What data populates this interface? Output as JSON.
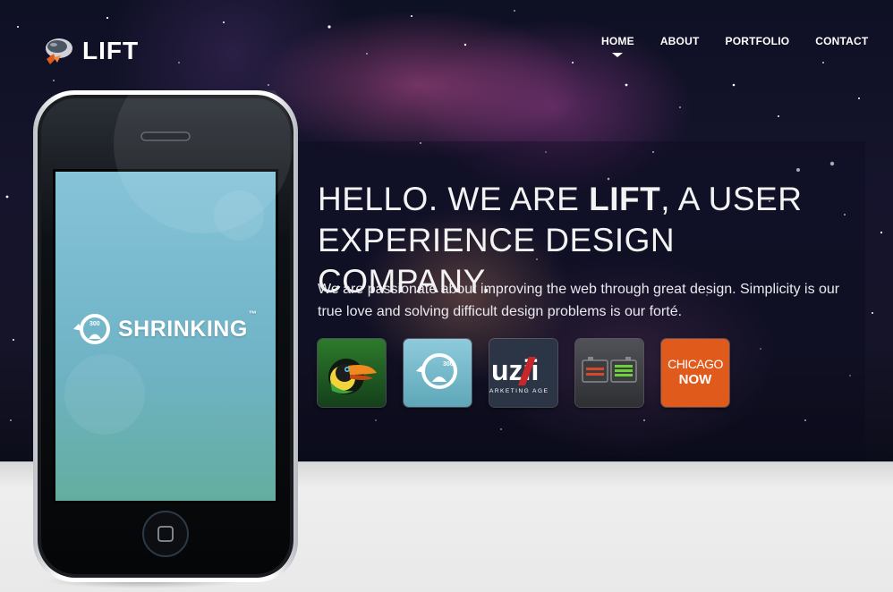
{
  "header": {
    "logo_text": "LIFT",
    "logo_icon": "rocket-helmet-icon"
  },
  "nav": {
    "items": [
      {
        "label": "HOME",
        "active": true
      },
      {
        "label": "ABOUT",
        "active": false
      },
      {
        "label": "PORTFOLIO",
        "active": false
      },
      {
        "label": "CONTACT",
        "active": false
      }
    ]
  },
  "hero": {
    "headline_part1": "HELLO. WE ARE ",
    "headline_strong": "LIFT",
    "headline_part2": ", A USER EXPERIENCE DESIGN COMPANY.",
    "subtext": "We are passionate about improving the web through great design. Simplicity is our true love and solving difficult design problems is our forté."
  },
  "portfolio": {
    "thumbs": [
      {
        "name": "toucan-app-icon",
        "label": ""
      },
      {
        "name": "shrinking-app-icon",
        "label": "300"
      },
      {
        "name": "uzii-marketing-icon",
        "label": "uzii",
        "sublabel": "ARKETING AGE"
      },
      {
        "name": "battery-app-icon",
        "label": ""
      },
      {
        "name": "chicago-now-icon",
        "label": "CHICAGO",
        "sublabel": "NOW"
      }
    ]
  },
  "phone": {
    "app_name": "SHRINKING",
    "trademark": "™",
    "dial_value": "300"
  },
  "colors": {
    "accent_orange": "#e05a1c",
    "screen_teal": "#6fb3c8",
    "hero_dark": "#15142c"
  }
}
